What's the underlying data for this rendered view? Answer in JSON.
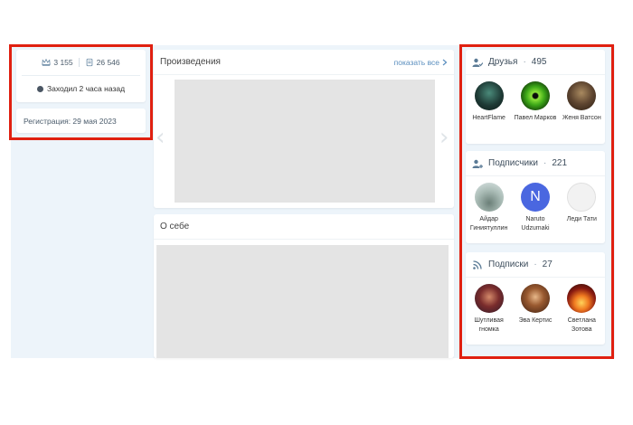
{
  "stats": {
    "rating": "3 155",
    "views": "26 546",
    "last_seen": "Заходил 2 часа назад"
  },
  "registration": "Регистрация: 29 мая 2023",
  "works": {
    "title": "Произведения",
    "show_all": "показать все"
  },
  "about": {
    "title": "О себе"
  },
  "friends": {
    "label": "Друзья",
    "count": "495",
    "people": [
      {
        "name": "HeartFlame"
      },
      {
        "name": "Павел Марков"
      },
      {
        "name": "Женя Ватсон"
      }
    ]
  },
  "subscribers": {
    "label": "Подписчики",
    "count": "221",
    "people": [
      {
        "name": "Айдар Гиниятуллин"
      },
      {
        "name": "Naruto Udzumaki",
        "initial": "N"
      },
      {
        "name": "Леди Тати"
      }
    ]
  },
  "subscriptions": {
    "label": "Подписки",
    "count": "27",
    "people": [
      {
        "name": "Шутливая гномка"
      },
      {
        "name": "Эва Кертис"
      },
      {
        "name": "Светлана Зотова"
      }
    ]
  },
  "colors": {
    "highlight": "#e02010",
    "link": "#5b8fbf",
    "page_bg": "#edf4fa"
  }
}
